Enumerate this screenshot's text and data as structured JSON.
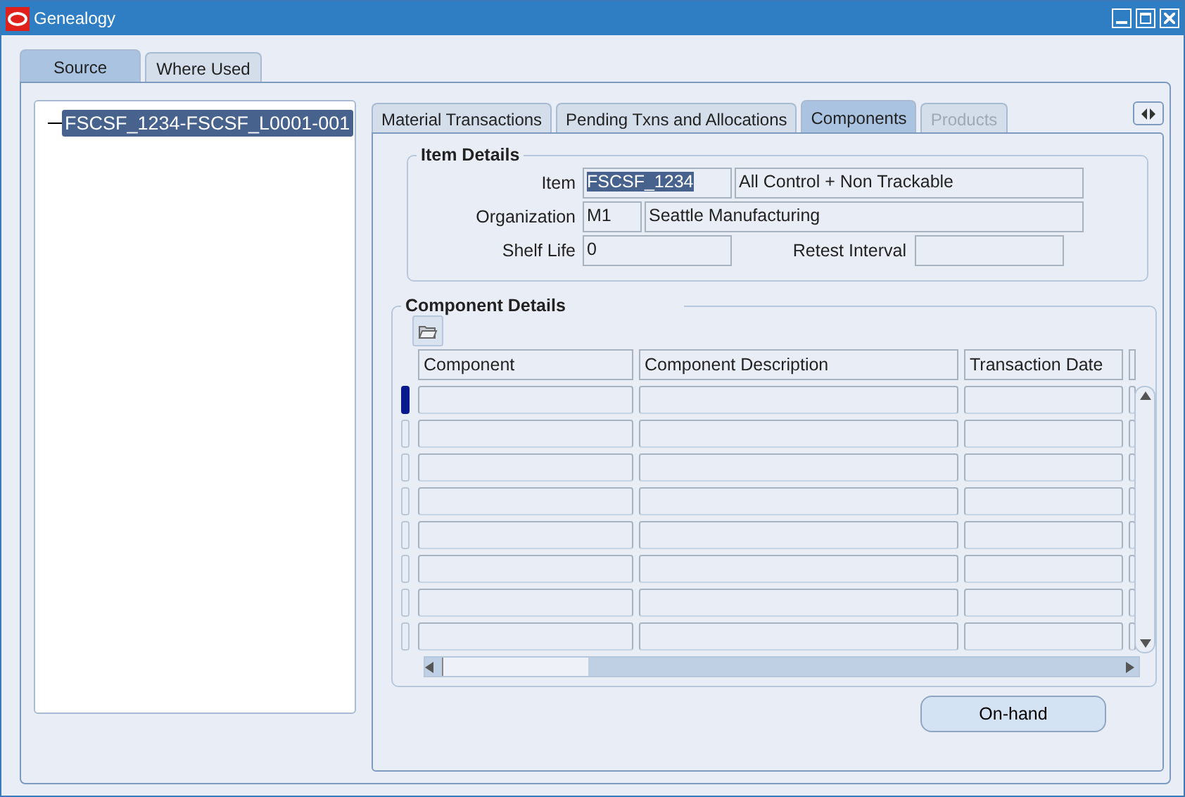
{
  "window": {
    "title": "Genealogy"
  },
  "source_tabs": [
    {
      "label": "Source",
      "selected": true
    },
    {
      "label": "Where Used",
      "selected": false
    }
  ],
  "tree": {
    "items": [
      {
        "label": "FSCSF_1234-FSCSF_L0001-001",
        "selected": true
      }
    ]
  },
  "detail_tabs": [
    {
      "label": "Material Transactions",
      "selected": false,
      "disabled": false
    },
    {
      "label": "Pending Txns and Allocations",
      "selected": false,
      "disabled": false
    },
    {
      "label": "Components",
      "selected": true,
      "disabled": false
    },
    {
      "label": "Products",
      "selected": false,
      "disabled": true
    }
  ],
  "item_details": {
    "title": "Item Details",
    "item": {
      "label": "Item",
      "code": "FSCSF_1234",
      "code_highlighted": true,
      "description": "All Control + Non Trackable"
    },
    "organization": {
      "label": "Organization",
      "code": "M1",
      "name": "Seattle Manufacturing"
    },
    "shelf_life": {
      "label": "Shelf Life",
      "value": "0"
    },
    "retest_interval": {
      "label": "Retest Interval"
    }
  },
  "component_details": {
    "title": "Component Details",
    "columns": [
      "Component",
      "Component Description",
      "Transaction Date"
    ],
    "rows": [
      {
        "selected": true
      },
      {
        "selected": false
      },
      {
        "selected": false
      },
      {
        "selected": false
      },
      {
        "selected": false
      },
      {
        "selected": false
      },
      {
        "selected": false
      },
      {
        "selected": false
      }
    ]
  },
  "buttons": [
    {
      "label": "On-hand"
    }
  ]
}
